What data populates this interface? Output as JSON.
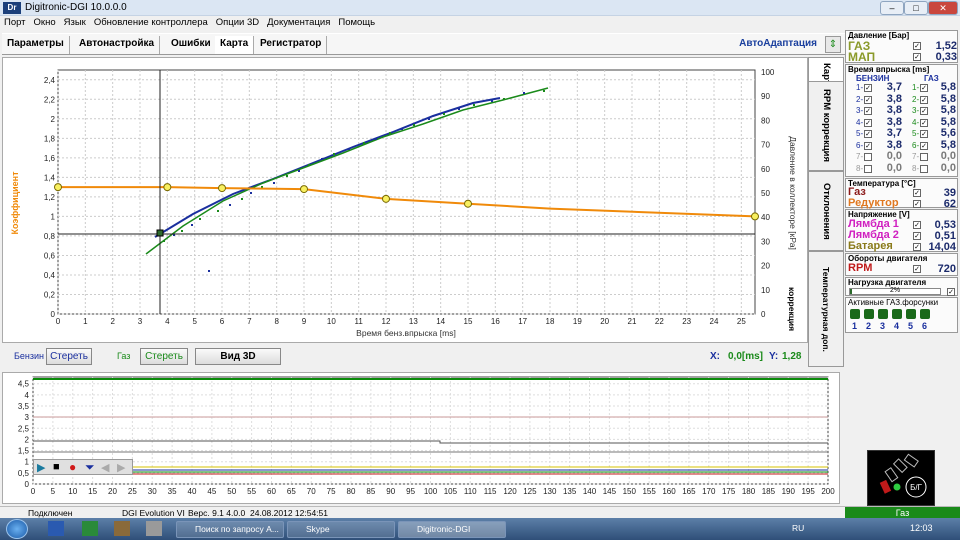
{
  "window": {
    "title": "Digitronic-DGI  10.0.0.0",
    "logo": "Dr"
  },
  "menu": [
    "Порт",
    "Окно",
    "Язык",
    "Обновление контроллера",
    "Опции 3D",
    "Документация",
    "Помощь"
  ],
  "tabs": [
    "Параметры",
    "Автонастройка",
    "Ошибки",
    "Карта",
    "Регистратор"
  ],
  "auto_adaptation": "АвтоАдаптация",
  "vertical_tabs": [
    "Карта",
    "RPM коррекция",
    "Отклонения",
    "Температурная доп. коррекция",
    "Давления доп.коррекция"
  ],
  "plot": {
    "y_left_label": "Коэффициент",
    "y_right_label": "Давление в коллекторе [кРа]",
    "x_label": "Время бенз.впрыска [ms]",
    "y_left_ticks": [
      "2,4",
      "2,2",
      "2",
      "1,8",
      "1,6",
      "1,4",
      "1,2",
      "1",
      "0,8",
      "0,6",
      "0,4",
      "0,2",
      "0"
    ],
    "y_right_ticks": [
      "100",
      "90",
      "80",
      "70",
      "60",
      "50",
      "40",
      "30",
      "20",
      "10",
      "0"
    ],
    "x_ticks": [
      "0",
      "1",
      "2",
      "3",
      "4",
      "5",
      "6",
      "7",
      "8",
      "9",
      "10",
      "11",
      "12",
      "13",
      "14",
      "15",
      "16",
      "17",
      "18",
      "19",
      "20",
      "21",
      "22",
      "23",
      "24",
      "25"
    ],
    "coef_curve": [
      [
        0,
        1.3
      ],
      [
        4,
        1.3
      ],
      [
        6,
        1.29
      ],
      [
        9,
        1.28
      ],
      [
        12,
        1.18
      ],
      [
        15,
        1.13
      ],
      [
        18,
        1.08
      ],
      [
        25.5,
        1.0
      ]
    ],
    "coef_points": [
      [
        0,
        1.3
      ],
      [
        4,
        1.3
      ],
      [
        6,
        1.29
      ],
      [
        9,
        1.28
      ],
      [
        12,
        1.18
      ],
      [
        15,
        1.13
      ],
      [
        25.5,
        1.0
      ]
    ],
    "cursor": {
      "x": 3.75,
      "y": 0.85
    }
  },
  "legend": {
    "petrol": "Бензин",
    "petrol_clear": "Стереть",
    "gas": "Газ",
    "gas_clear": "Стереть",
    "view3d": "Вид 3D",
    "x_label": "X:",
    "x_value": "0,0[ms]",
    "y_label": "Y:",
    "y_value": "1,28"
  },
  "pressure": {
    "title": "Давление [Бар]",
    "gas_label": "ГАЗ",
    "gas_value": "1,52",
    "map_label": "МАП",
    "map_value": "0,33"
  },
  "injection": {
    "title": "Время впрыска [ms]",
    "petrol_header": "БЕНЗИН",
    "gas_header": "ГАЗ",
    "rows": [
      {
        "n": "1",
        "p": "3,7",
        "g": "5,8"
      },
      {
        "n": "2",
        "p": "3,8",
        "g": "5,8"
      },
      {
        "n": "3",
        "p": "3,8",
        "g": "5,8"
      },
      {
        "n": "4",
        "p": "3,8",
        "g": "5,8"
      },
      {
        "n": "5",
        "p": "3,7",
        "g": "5,6"
      },
      {
        "n": "6",
        "p": "3,8",
        "g": "5,8"
      },
      {
        "n": "7",
        "p": "0,0",
        "g": "0,0"
      },
      {
        "n": "8",
        "p": "0,0",
        "g": "0,0"
      }
    ]
  },
  "temperature": {
    "title": "Температура [°C]",
    "gas_label": "Газ",
    "gas_value": "39",
    "reducer_label": "Редуктор",
    "reducer_value": "62"
  },
  "voltage": {
    "title": "Напряжение [V]",
    "l1_label": "Лямбда 1",
    "l1_value": "0,53",
    "l2_label": "Лямбда 2",
    "l2_value": "0,51",
    "bat_label": "Батарея",
    "bat_value": "14,04"
  },
  "rpm": {
    "title": "Обороты двигателя",
    "label": "RPM",
    "value": "720"
  },
  "load": {
    "title": "Нагрузка двигателя",
    "value": "2%",
    "fraction": 0.02
  },
  "injectors": {
    "title": "Активные ГАЗ.форсунки",
    "numbers": [
      "1",
      "2",
      "3",
      "4",
      "5",
      "6"
    ]
  },
  "gauge": {
    "label": "Б/Г"
  },
  "status": {
    "connected": "Подключен",
    "device": "DGI Evolution VI",
    "version": "Верс. 9.1  4.0.0",
    "datetime": "24.08.2012 12:54:51",
    "fuel": "Газ"
  },
  "bottom": {
    "y_ticks": [
      "4,5",
      "4",
      "3,5",
      "3",
      "2,5",
      "2",
      "1,5",
      "1",
      "0,5",
      "0"
    ],
    "x_ticks": [
      "0",
      "5",
      "10",
      "15",
      "20",
      "25",
      "30",
      "35",
      "40",
      "45",
      "50",
      "55",
      "60",
      "65",
      "70",
      "75",
      "80",
      "85",
      "90",
      "95",
      "100",
      "105",
      "110",
      "115",
      "120",
      "125",
      "130",
      "135",
      "140",
      "145",
      "150",
      "155",
      "160",
      "165",
      "170",
      "175",
      "180",
      "185",
      "190",
      "195",
      "200"
    ]
  },
  "taskbar": {
    "tasks": [
      "Поиск по запросу A...",
      "Skype",
      "Digitronic-DGI"
    ],
    "lang": "RU",
    "clock": "12:03"
  },
  "colors": {
    "petrol": "#1a2f9e",
    "gas": "#1a8a1a",
    "coef": "#f08a0a",
    "status_green": "#1a8a1a"
  }
}
